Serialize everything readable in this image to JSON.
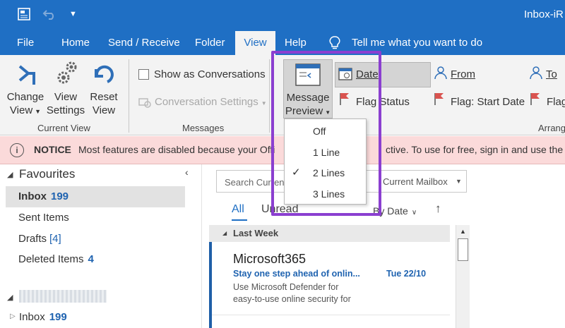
{
  "titlebar": {
    "title": "Inbox-iR"
  },
  "tabs": [
    {
      "label": "File"
    },
    {
      "label": "Home"
    },
    {
      "label": "Send / Receive"
    },
    {
      "label": "Folder"
    },
    {
      "label": "View"
    },
    {
      "label": "Help"
    }
  ],
  "tell_me": "Tell me what you want to do",
  "ribbon": {
    "change_view_1": "Change",
    "change_view_2": "View",
    "view_settings_1": "View",
    "view_settings_2": "Settings",
    "reset_view_1": "Reset",
    "reset_view_2": "View",
    "group_current_view": "Current View",
    "show_conversations": "Show as Conversations",
    "conversation_settings": "Conversation Settings",
    "group_messages": "Messages",
    "message_preview_1": "Message",
    "message_preview_2": "Preview",
    "date": "Date",
    "from": "From",
    "to": "To",
    "flag_status": "Flag Status",
    "flag_start_date": "Flag: Start Date",
    "flag_more": "Flag",
    "group_arrangement": "Arrang"
  },
  "preview_menu": {
    "items": [
      "Off",
      "1 Line",
      "2 Lines",
      "3 Lines"
    ],
    "checked": "2 Lines"
  },
  "notice": {
    "label": "NOTICE",
    "text_left": "Most features are disabled because your Offi",
    "text_right": "ctive. To use for free, sign in and use the Web"
  },
  "nav": {
    "favourites": "Favourites",
    "inbox": "Inbox",
    "inbox_count": "199",
    "sent": "Sent Items",
    "drafts": "Drafts",
    "drafts_count": "[4]",
    "deleted": "Deleted Items",
    "deleted_count": "4",
    "inbox2": "Inbox",
    "inbox2_count": "199"
  },
  "list": {
    "search_placeholder": "Search Curren",
    "mailbox": "Current Mailbox",
    "tab_all": "All",
    "tab_unread": "Unread",
    "sort": "By Date",
    "group": "Last Week",
    "message": {
      "sender": "Microsoft365",
      "subject": "Stay one step ahead of onlin...",
      "date": "Tue 22/10",
      "preview_1": "Use Microsoft Defender for",
      "preview_2": "easy-to-use online security for"
    }
  },
  "colors": {
    "accent": "#1f6fc4",
    "highlight": "#8b3fd0",
    "notice_bg": "#fbdada"
  }
}
